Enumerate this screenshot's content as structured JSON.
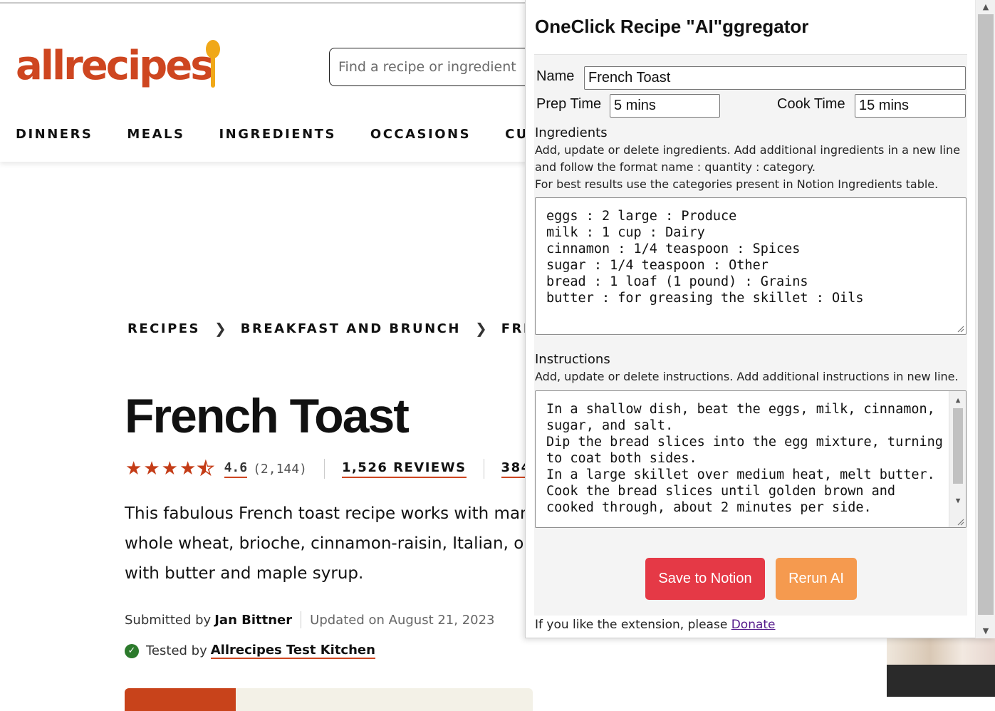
{
  "site": {
    "logo_text": "allrecipes",
    "search_placeholder": "Find a recipe or ingredient",
    "nav": [
      "DINNERS",
      "MEALS",
      "INGREDIENTS",
      "OCCASIONS",
      "CUISINES"
    ],
    "breadcrumbs": [
      "RECIPES",
      "BREAKFAST AND BRUNCH",
      "FRENCH T"
    ],
    "recipe_title": "French Toast",
    "rating": "4.6",
    "rating_count": "(2,144)",
    "rating_stars": 4.5,
    "reviews": "1,526 REVIEWS",
    "photos": "384",
    "description": "This fabulous French toast recipe works with many whole wheat, brioche, cinnamon-raisin, Italian, or with butter and maple syrup.",
    "submitted_prefix": "Submitted by",
    "author": "Jan Bittner",
    "updated": "Updated on August 21, 2023",
    "tested_prefix": "Tested by",
    "tested_by": "Allrecipes Test Kitchen",
    "brand_color": "#ce4620"
  },
  "popup": {
    "title": "OneClick Recipe \"AI\"ggregator",
    "name_label": "Name",
    "name_value": "French Toast",
    "prep_label": "Prep Time",
    "prep_value": "5 mins",
    "cook_label": "Cook Time",
    "cook_value": "15 mins",
    "ingredients_title": "Ingredients",
    "ingredients_help": "Add, update or delete ingredients. Add additional ingredients in a new line and follow the format name : quantity : category.",
    "ingredients_help2": "For best results use the categories present in Notion Ingredients table.",
    "ingredients": [
      "eggs : 2 large : Produce",
      "milk : 1 cup : Dairy",
      "cinnamon : 1/4 teaspoon : Spices",
      "sugar : 1/4 teaspoon : Other",
      "bread : 1 loaf (1 pound) : Grains",
      "butter : for greasing the skillet : Oils"
    ],
    "instructions_title": "Instructions",
    "instructions_help": "Add, update or delete instructions. Add additional instructions in new line.",
    "instructions": [
      "In a shallow dish, beat the eggs, milk, cinnamon,",
      "sugar, and salt.",
      "Dip the bread slices into the egg mixture, turning",
      "to coat both sides.",
      "In a large skillet over medium heat, melt butter.",
      "Cook the bread slices until golden brown and",
      "cooked through, about 2 minutes per side."
    ],
    "save_label": "Save to Notion",
    "rerun_label": "Rerun AI",
    "footer_text": "If you like the extension, please",
    "donate_label": "Donate",
    "save_color": "#e53946",
    "rerun_color": "#f59a4f"
  }
}
